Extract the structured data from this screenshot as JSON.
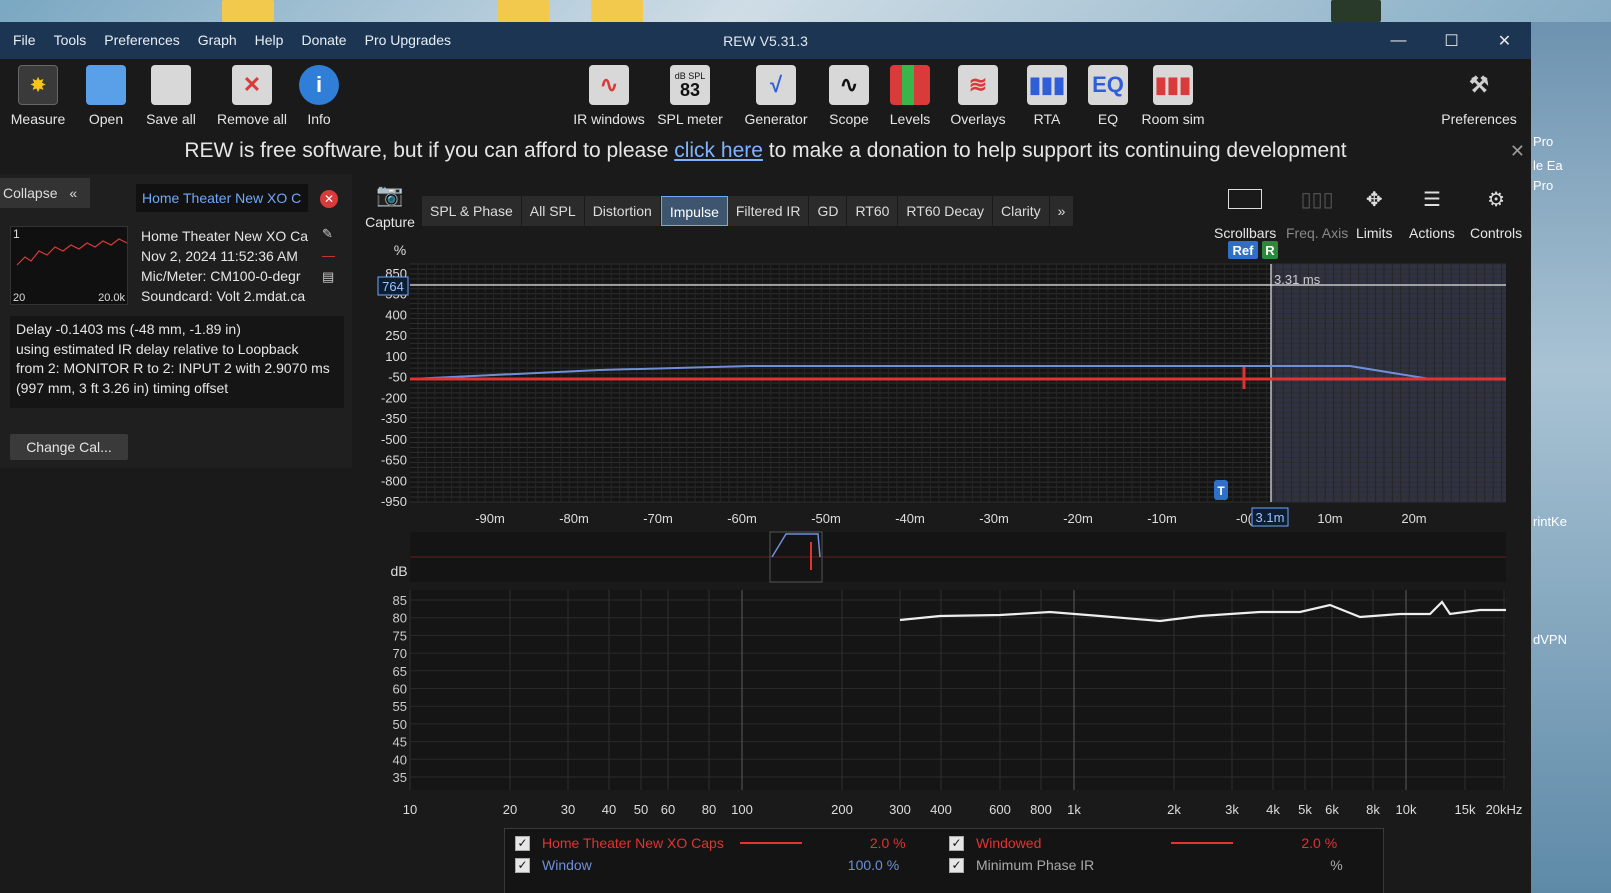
{
  "window": {
    "title": "REW V5.31.3",
    "controls": [
      "—",
      "☐",
      "✕"
    ]
  },
  "menu": [
    "File",
    "Tools",
    "Preferences",
    "Graph",
    "Help",
    "Donate",
    "Pro Upgrades"
  ],
  "toolbar": {
    "left": [
      {
        "label": "Measure",
        "icon": "measure-icon"
      },
      {
        "label": "Open",
        "icon": "folder-icon"
      },
      {
        "label": "Save all",
        "icon": "save-all-icon"
      },
      {
        "label": "Remove all",
        "icon": "remove-all-icon"
      },
      {
        "label": "Info",
        "icon": "info-icon"
      }
    ],
    "center": [
      {
        "label": "IR windows",
        "icon": "ir-windows-icon"
      },
      {
        "label": "SPL meter",
        "icon": "spl-meter-icon",
        "badge": "83",
        "badge_sub": "dB SPL"
      },
      {
        "label": "Generator",
        "icon": "generator-icon"
      },
      {
        "label": "Scope",
        "icon": "scope-icon"
      },
      {
        "label": "Levels",
        "icon": "levels-icon"
      },
      {
        "label": "Overlays",
        "icon": "overlays-icon"
      },
      {
        "label": "RTA",
        "icon": "rta-icon"
      },
      {
        "label": "EQ",
        "icon": "eq-icon",
        "badge": "EQ"
      },
      {
        "label": "Room sim",
        "icon": "room-sim-icon"
      }
    ],
    "preferences": "Preferences"
  },
  "donation": {
    "before": "REW is free software, but if you can afford to please ",
    "link": "click here",
    "after": " to make a donation to help support its continuing development"
  },
  "left_panel": {
    "collapse": "Collapse",
    "measurement_tab": "Home Theater New XO C",
    "thumb_index": "1",
    "thumb_min": "20",
    "thumb_max": "20.0k",
    "info_lines": [
      "Home Theater New XO Ca",
      "Nov 2, 2024 11:52:36 AM",
      "Mic/Meter: CM100-0-degr",
      "Soundcard: Volt 2.mdat.ca"
    ],
    "delay_lines": [
      "Delay -0.1403 ms (-48 mm, -1.89 in)",
      "using estimated IR delay relative to Loopback",
      "from 2: MONITOR R to 2: INPUT 2 with 2.9070 ms",
      "(997 mm, 3 ft 3.26 in) timing offset"
    ],
    "change_cal": "Change Cal..."
  },
  "graph_tabs": {
    "capture": "Capture",
    "tabs": [
      "SPL & Phase",
      "All SPL",
      "Distortion",
      "Impulse",
      "Filtered IR",
      "GD",
      "RT60",
      "RT60 Decay",
      "Clarity",
      "»"
    ],
    "active": "Impulse"
  },
  "right_tools": [
    {
      "label": "Scrollbars",
      "icon": "scrollbars-icon"
    },
    {
      "label": "Freq. Axis",
      "icon": "freq-axis-icon"
    },
    {
      "label": "Limits",
      "icon": "limits-icon"
    },
    {
      "label": "Actions",
      "icon": "actions-icon"
    },
    {
      "label": "Controls",
      "icon": "gear-icon"
    }
  ],
  "impulse_graph": {
    "y_unit": "%",
    "y_ticks": [
      "850",
      "550",
      "400",
      "250",
      "100",
      "-50",
      "-200",
      "-350",
      "-500",
      "-650",
      "-800",
      "-950"
    ],
    "y_cursor": "764",
    "x_ticks": [
      "-90m",
      "-80m",
      "-70m",
      "-60m",
      "-50m",
      "-40m",
      "-30m",
      "-20m",
      "-10m",
      "-0(",
      "10m",
      "20m"
    ],
    "x_cursor": "3.1m",
    "cursor_readout": "3.31 ms",
    "ref_marker": "Ref",
    "r_marker": "R",
    "t_marker": "T"
  },
  "freq_graph": {
    "y_unit": "dB",
    "y_ticks": [
      "85",
      "80",
      "75",
      "70",
      "65",
      "60",
      "55",
      "50",
      "45",
      "40",
      "35"
    ],
    "x_ticks": [
      "10",
      "20",
      "30",
      "40",
      "50",
      "60",
      "80",
      "100",
      "200",
      "300",
      "400",
      "600",
      "800",
      "1k",
      "2k",
      "3k",
      "4k",
      "5k",
      "6k",
      "8k",
      "10k",
      "15k",
      "20kHz"
    ]
  },
  "legend": [
    {
      "name": "Home Theater New XO Caps",
      "value": "2.0 %"
    },
    {
      "name": "Windowed",
      "value": "2.0 %"
    },
    {
      "name": "Window",
      "value": "100.0 %"
    },
    {
      "name": "Minimum Phase IR",
      "value": "%"
    }
  ],
  "desktop_right": [
    "Pro",
    "le Ea",
    "Pro",
    "rintKe",
    "dVPN"
  ],
  "colors": {
    "accent_blue": "#6fa8ff",
    "trace_red": "#e23232",
    "trace_blue": "#6f8fd8",
    "title_bar": "#1c3552"
  }
}
